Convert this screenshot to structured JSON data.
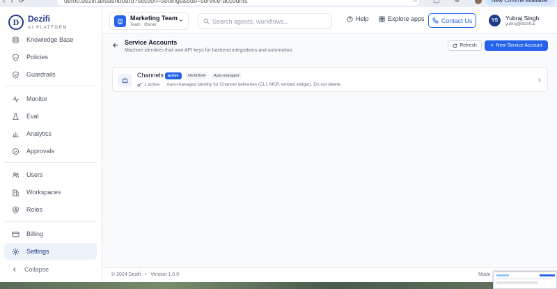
{
  "browser": {
    "url": "demo.dezifi.ai/dashboard?section=settings&sub=service-accounts",
    "update_label": "New Chrome available"
  },
  "brand": {
    "name": "Dezifi",
    "subtitle": "AI PLATFORM",
    "logo_letter": "D"
  },
  "sidebar": {
    "items": [
      {
        "label": "Knowledge Base",
        "icon": "database-icon"
      },
      {
        "label": "Policies",
        "icon": "shield-icon"
      },
      {
        "label": "Guardrails",
        "icon": "shield-check-icon"
      },
      {
        "label": "Monitor",
        "icon": "activity-icon"
      },
      {
        "label": "Eval",
        "icon": "flask-icon"
      },
      {
        "label": "Analytics",
        "icon": "bar-chart-icon"
      },
      {
        "label": "Approvals",
        "icon": "check-circle-icon"
      },
      {
        "label": "Users",
        "icon": "users-icon"
      },
      {
        "label": "Workspaces",
        "icon": "building-icon"
      },
      {
        "label": "Roles",
        "icon": "shield-user-icon"
      },
      {
        "label": "Billing",
        "icon": "credit-card-icon"
      },
      {
        "label": "Settings",
        "icon": "gear-icon",
        "active": true
      }
    ],
    "collapse_label": "Collapse"
  },
  "header": {
    "team_name": "Marketing Team",
    "team_role": "Team · Owner",
    "search_placeholder": "Search agents, workflows...",
    "help_label": "Help",
    "explore_label": "Explore apps",
    "contact_label": "Contact Us",
    "user_initials": "YS",
    "user_name": "Yubraj Singh",
    "user_email": "yubraj@dezifi.ai"
  },
  "page": {
    "title": "Service Accounts",
    "subtitle": "Machine identities that own API keys for backend integrations and automation.",
    "refresh_label": "Refresh",
    "new_label": "New Service Account"
  },
  "accounts": [
    {
      "name": "Channels",
      "status": "active",
      "role": "MEMBER",
      "tag": "Auto-managed",
      "keys": "1 active",
      "description": "Auto-managed identity for Channel deliveries (CLI, MCP, embed widget). Do not delete."
    }
  ],
  "footer": {
    "copyright": "© 2024 Dezifi",
    "version": "Version 1.0.0",
    "made": "Made"
  },
  "colors": {
    "accent": "#2563eb",
    "brand": "#1e3a8a",
    "active_nav_bg": "#eef2fb"
  }
}
